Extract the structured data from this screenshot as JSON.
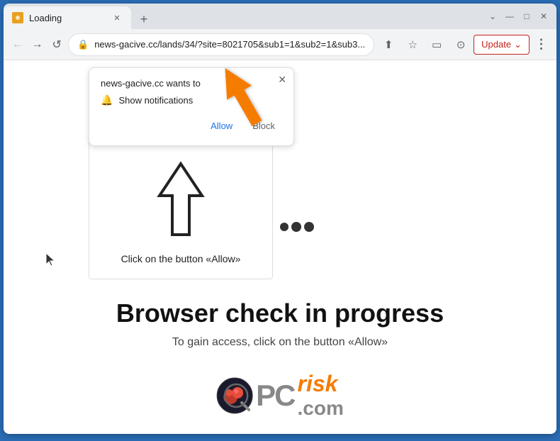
{
  "browser": {
    "tab": {
      "label": "Loading",
      "favicon": "🔥"
    },
    "address": "news-gacive.cc/lands/34/?site=8021705&sub1=1&sub2=1&sub3...",
    "new_tab_label": "+",
    "window_controls": {
      "chevron_down": "⌄",
      "minimize": "—",
      "maximize": "□",
      "close": "✕"
    },
    "nav": {
      "back": "←",
      "forward": "→",
      "reload": "↺"
    },
    "toolbar_icons": {
      "share": "⬆",
      "bookmark": "☆",
      "side_panel": "▭",
      "profile": "⊙"
    },
    "update_button_label": "Update",
    "menu_dots": "⋮"
  },
  "notification_popup": {
    "site_text": "news-gacive.cc wants to",
    "close_btn": "✕",
    "notification_label": "Show notifications",
    "allow_btn": "Allow",
    "block_btn": "Block"
  },
  "main_box": {
    "click_text": "Click on the button «Allow»"
  },
  "page": {
    "heading": "Browser check in progress",
    "subtext": "To gain access, click on the button «Allow»"
  },
  "logo": {
    "pc": "PC",
    "risk": "risk",
    "dot_com": ".com"
  }
}
